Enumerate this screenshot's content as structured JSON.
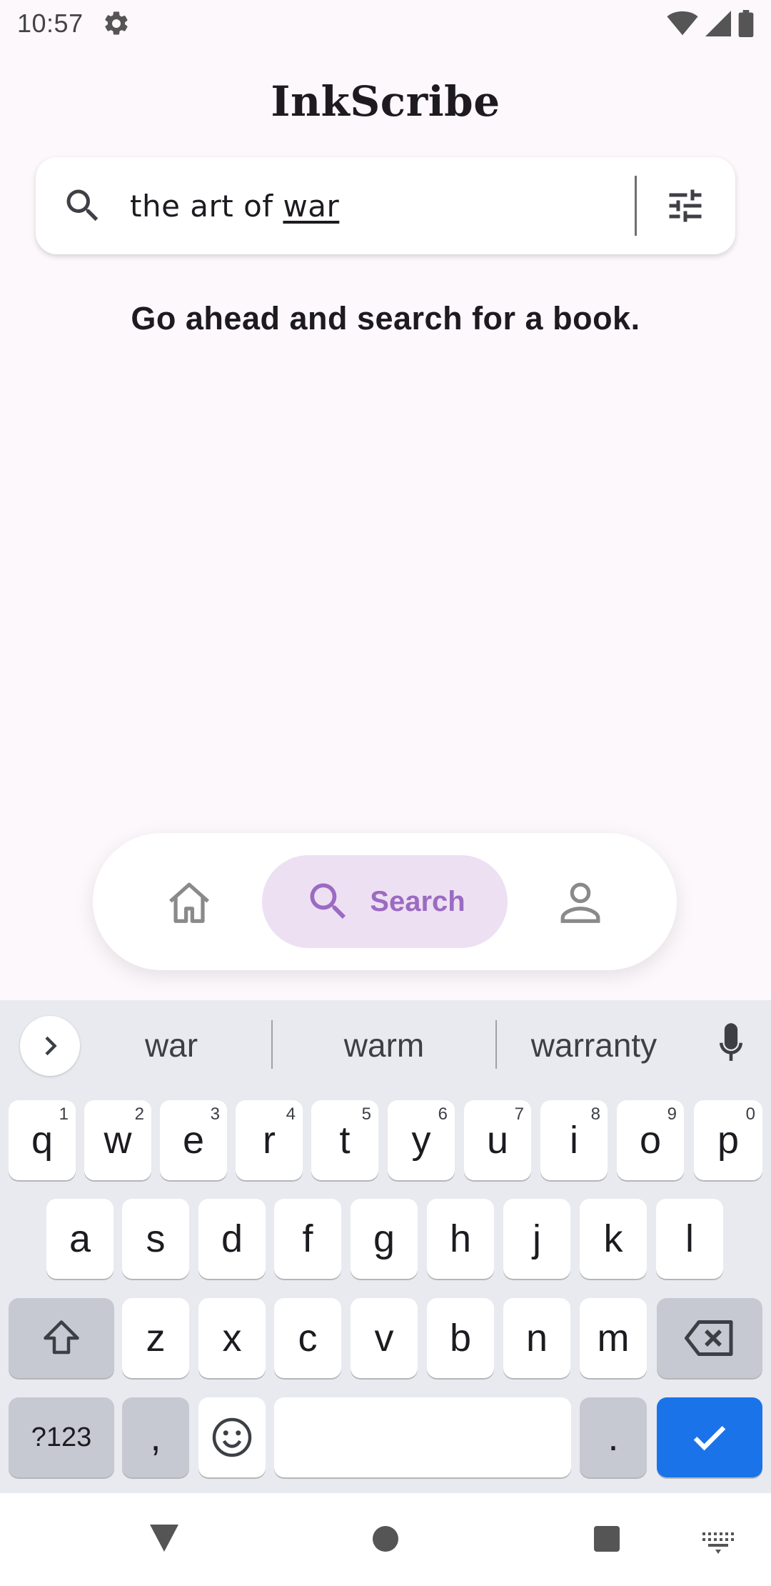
{
  "status_bar": {
    "time": "10:57",
    "icons": [
      "settings-gear-icon",
      "wifi-icon",
      "signal-icon",
      "battery-icon"
    ]
  },
  "app": {
    "title": "InkScribe"
  },
  "search": {
    "query_prefix": "the art of ",
    "query_typed": "war",
    "icons": [
      "search-icon",
      "filter-sliders-icon"
    ]
  },
  "main": {
    "hint": "Go ahead and search for a book."
  },
  "bottom_nav": {
    "items": [
      {
        "name": "home",
        "icon": "home-icon",
        "active": false
      },
      {
        "name": "search",
        "icon": "search-icon",
        "label": "Search",
        "active": true
      },
      {
        "name": "profile",
        "icon": "person-icon",
        "active": false
      }
    ],
    "active_color": "#9b6bc2",
    "active_bg": "#ede0f3"
  },
  "keyboard": {
    "suggestions": [
      "war",
      "warm",
      "warranty"
    ],
    "row1": [
      {
        "key": "q",
        "hint": "1"
      },
      {
        "key": "w",
        "hint": "2"
      },
      {
        "key": "e",
        "hint": "3"
      },
      {
        "key": "r",
        "hint": "4"
      },
      {
        "key": "t",
        "hint": "5"
      },
      {
        "key": "y",
        "hint": "6"
      },
      {
        "key": "u",
        "hint": "7"
      },
      {
        "key": "i",
        "hint": "8"
      },
      {
        "key": "o",
        "hint": "9"
      },
      {
        "key": "p",
        "hint": "0"
      }
    ],
    "row2": [
      "a",
      "s",
      "d",
      "f",
      "g",
      "h",
      "j",
      "k",
      "l"
    ],
    "row3": [
      "z",
      "x",
      "c",
      "v",
      "b",
      "n",
      "m"
    ],
    "symbols_label": "?123",
    "comma": ",",
    "period": ".",
    "enter_color": "#1a73e8"
  }
}
